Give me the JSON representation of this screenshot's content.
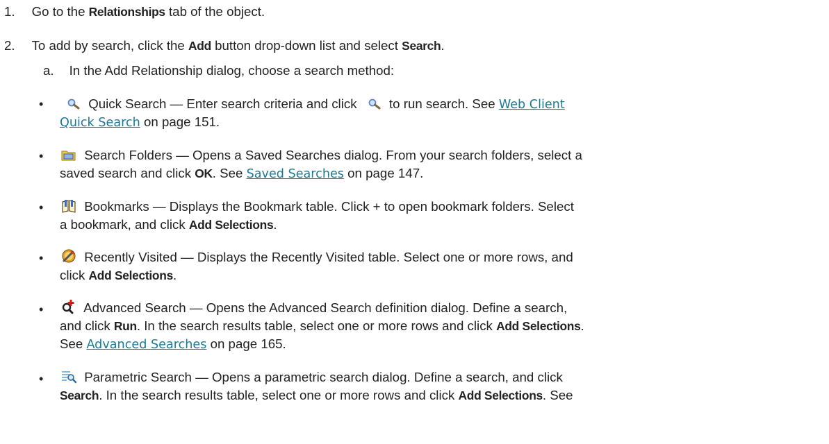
{
  "steps": {
    "s1": {
      "num": "1.",
      "pre": "Go to the ",
      "b1": "Relationships",
      "post": " tab of the object."
    },
    "s2": {
      "num": "2.",
      "pre": "To add by search, click the ",
      "b1": "Add",
      "mid": " button drop-down list and select ",
      "b2": "Search",
      "post": "."
    },
    "a": {
      "letter": "a.",
      "text": "In the Add Relationship dialog, choose a search method:"
    }
  },
  "items": {
    "quick": {
      "icon": "magnifier-icon",
      "l1_pre": " Quick Search — Enter search criteria and click ",
      "l1_post": " to run search. See ",
      "link_part1": "Web Client ",
      "link_part2": "Quick Search",
      "l2_post": " on page 151."
    },
    "folders": {
      "icon": "search-folder-icon",
      "l1": " Search Folders — Opens a Saved Searches dialog. From your search folders, select a",
      "l2_pre": "saved search and click ",
      "b1": "OK",
      "l2_mid": ". See ",
      "link": "Saved Searches",
      "l2_post": " on page 147."
    },
    "bookmarks": {
      "icon": "bookmarks-icon",
      "l1": " Bookmarks — Displays the Bookmark table. Click + to open bookmark folders. Select",
      "l2_pre": "a bookmark, and click ",
      "b1": "Add Selections",
      "l2_post": "."
    },
    "recent": {
      "icon": "recently-visited-icon",
      "l1": " Recently Visited — Displays the Recently Visited table. Select one or more rows, and",
      "l2_pre": "click ",
      "b1": "Add Selections",
      "l2_post": "."
    },
    "advanced": {
      "icon": "advanced-search-icon",
      "l1": " Advanced Search — Opens the Advanced Search definition dialog. Define a search,",
      "l2_pre": "and click ",
      "b1": "Run",
      "l2_mid": ". In the search results table, select one or more rows and click ",
      "b2": "Add Selections",
      "l2_post": ".",
      "l3_pre": "See ",
      "link": "Advanced Searches",
      "l3_post": " on page 165."
    },
    "parametric": {
      "icon": "parametric-search-icon",
      "l1": " Parametric Search — Opens a parametric search dialog. Define a search, and click",
      "b1": "Search",
      "l2_mid": ". In the search results table, select one or more rows and click ",
      "b2": "Add Selections",
      "l2_post": ". See"
    }
  }
}
